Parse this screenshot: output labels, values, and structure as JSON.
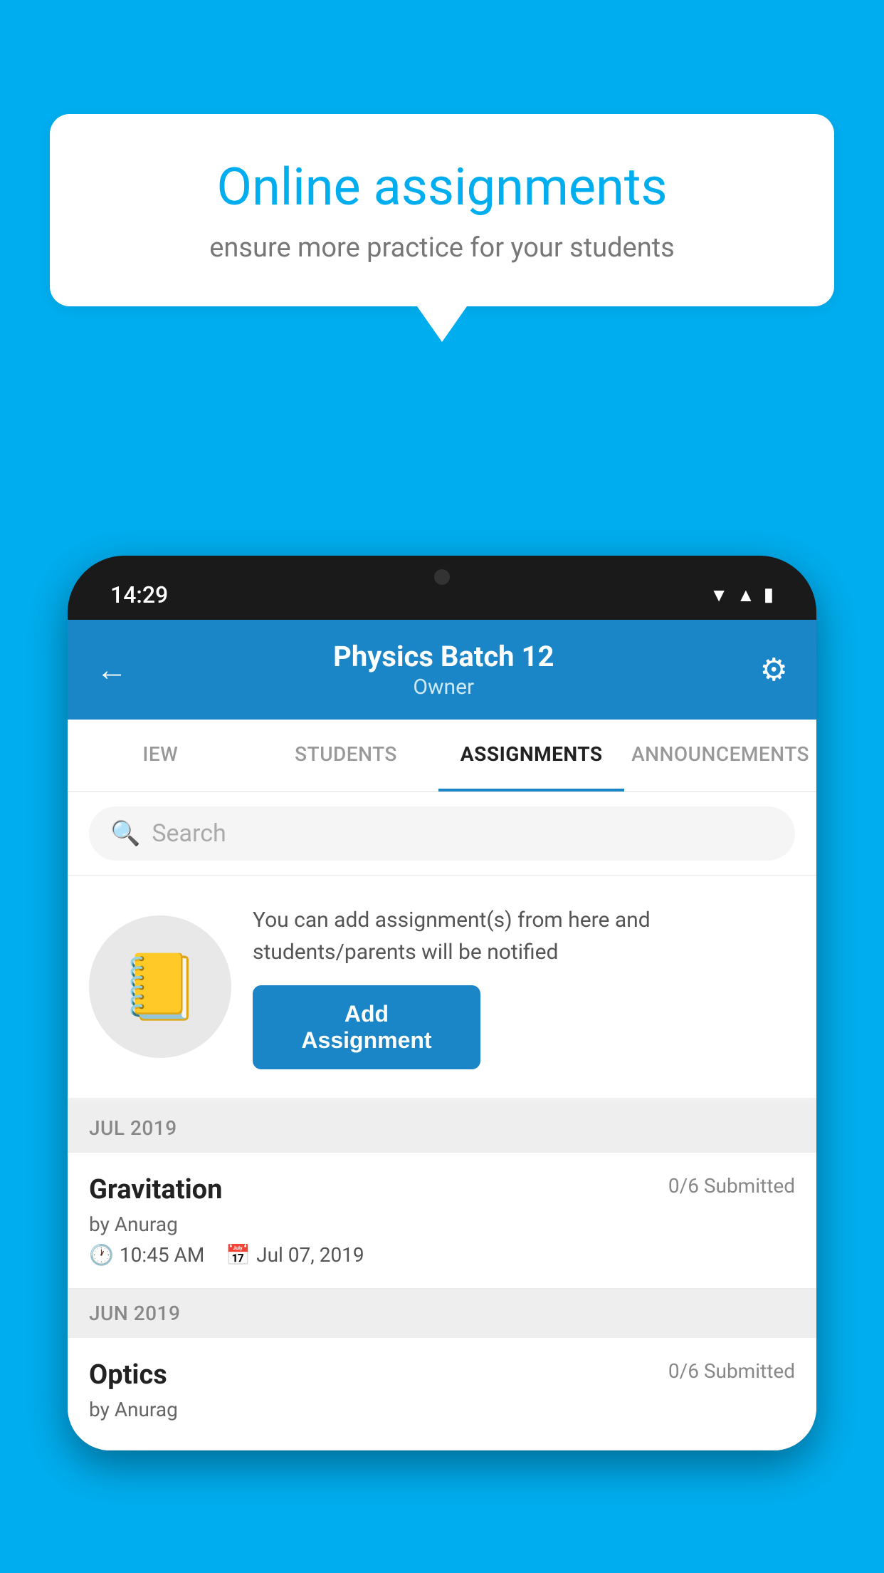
{
  "background": {
    "color": "#00AEEF"
  },
  "speech_bubble": {
    "title": "Online assignments",
    "subtitle": "ensure more practice for your students"
  },
  "phone": {
    "status_bar": {
      "time": "14:29",
      "icons": [
        "wifi",
        "signal",
        "battery"
      ]
    },
    "header": {
      "title": "Physics Batch 12",
      "subtitle": "Owner",
      "back_label": "←",
      "gear_label": "⚙"
    },
    "tabs": [
      {
        "label": "IEW",
        "active": false
      },
      {
        "label": "STUDENTS",
        "active": false
      },
      {
        "label": "ASSIGNMENTS",
        "active": true
      },
      {
        "label": "ANNOUNCEMENTS",
        "active": false
      }
    ],
    "search": {
      "placeholder": "Search"
    },
    "info_section": {
      "icon": "📒",
      "text": "You can add assignment(s) from here and students/parents will be notified",
      "button_label": "Add Assignment"
    },
    "sections": [
      {
        "month": "JUL 2019",
        "assignments": [
          {
            "name": "Gravitation",
            "submitted": "0/6 Submitted",
            "by": "by Anurag",
            "time": "10:45 AM",
            "date": "Jul 07, 2019"
          }
        ]
      },
      {
        "month": "JUN 2019",
        "assignments": [
          {
            "name": "Optics",
            "submitted": "0/6 Submitted",
            "by": "by Anurag",
            "time": "",
            "date": ""
          }
        ]
      }
    ]
  }
}
